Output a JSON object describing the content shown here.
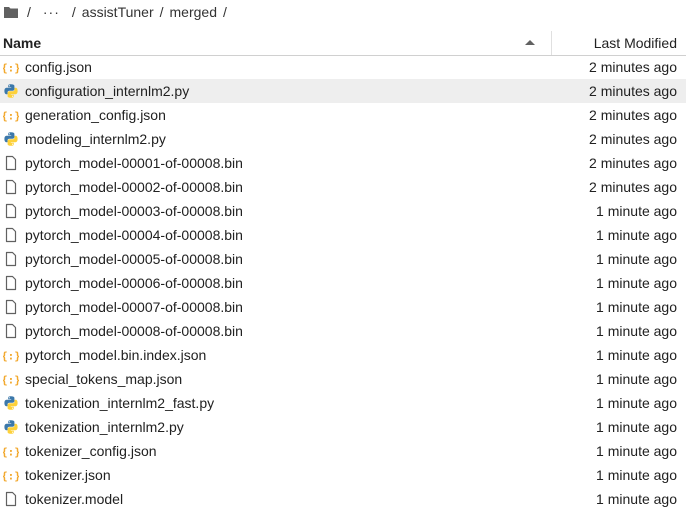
{
  "breadcrumb": {
    "root_sep": "/",
    "ellipsis": "···",
    "sep1": "/",
    "dir1": "assistTuner",
    "sep2": "/",
    "dir2": "merged",
    "sep3": "/"
  },
  "header": {
    "name_label": "Name",
    "modified_label": "Last Modified",
    "sort_direction": "ascending"
  },
  "files": [
    {
      "name": "config.json",
      "modified": "2 minutes ago",
      "icon": "json-icon"
    },
    {
      "name": "configuration_internlm2.py",
      "modified": "2 minutes ago",
      "icon": "python-icon",
      "selected": true
    },
    {
      "name": "generation_config.json",
      "modified": "2 minutes ago",
      "icon": "json-icon"
    },
    {
      "name": "modeling_internlm2.py",
      "modified": "2 minutes ago",
      "icon": "python-icon"
    },
    {
      "name": "pytorch_model-00001-of-00008.bin",
      "modified": "2 minutes ago",
      "icon": "file-icon"
    },
    {
      "name": "pytorch_model-00002-of-00008.bin",
      "modified": "2 minutes ago",
      "icon": "file-icon"
    },
    {
      "name": "pytorch_model-00003-of-00008.bin",
      "modified": "1 minute ago",
      "icon": "file-icon"
    },
    {
      "name": "pytorch_model-00004-of-00008.bin",
      "modified": "1 minute ago",
      "icon": "file-icon"
    },
    {
      "name": "pytorch_model-00005-of-00008.bin",
      "modified": "1 minute ago",
      "icon": "file-icon"
    },
    {
      "name": "pytorch_model-00006-of-00008.bin",
      "modified": "1 minute ago",
      "icon": "file-icon"
    },
    {
      "name": "pytorch_model-00007-of-00008.bin",
      "modified": "1 minute ago",
      "icon": "file-icon"
    },
    {
      "name": "pytorch_model-00008-of-00008.bin",
      "modified": "1 minute ago",
      "icon": "file-icon"
    },
    {
      "name": "pytorch_model.bin.index.json",
      "modified": "1 minute ago",
      "icon": "json-icon"
    },
    {
      "name": "special_tokens_map.json",
      "modified": "1 minute ago",
      "icon": "json-icon"
    },
    {
      "name": "tokenization_internlm2_fast.py",
      "modified": "1 minute ago",
      "icon": "python-icon"
    },
    {
      "name": "tokenization_internlm2.py",
      "modified": "1 minute ago",
      "icon": "python-icon"
    },
    {
      "name": "tokenizer_config.json",
      "modified": "1 minute ago",
      "icon": "json-icon"
    },
    {
      "name": "tokenizer.json",
      "modified": "1 minute ago",
      "icon": "json-icon"
    },
    {
      "name": "tokenizer.model",
      "modified": "1 minute ago",
      "icon": "file-icon"
    }
  ],
  "colors": {
    "json_icon": "#f2a92f",
    "python_blue": "#3c78aa",
    "python_yellow": "#fdd13a",
    "file_outline": "#616161",
    "selected_row": "#eeeeee"
  }
}
